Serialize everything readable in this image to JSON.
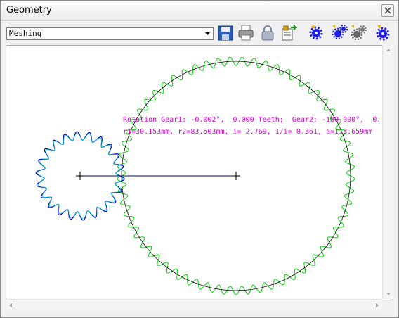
{
  "window": {
    "title": "Geometry"
  },
  "toolbar": {
    "mode_select": "Meshing",
    "buttons": [
      {
        "name": "save-icon"
      },
      {
        "name": "print-icon"
      },
      {
        "name": "lock-icon"
      },
      {
        "name": "export-icon"
      },
      {
        "name": "gear-icon-1"
      },
      {
        "name": "gear-icon-2"
      },
      {
        "name": "gear-icon-3"
      },
      {
        "name": "gear-icon-4"
      }
    ]
  },
  "drawing": {
    "line1": "Rotation Gear1: -0.002°,  0.000 Teeth;  Gear2: -180.000°,  0.",
    "line2": "r1=30.153mm, r2=83.503mm, i= 2.769, 1/i= 0.361, a=113.659mm",
    "colors": {
      "gear1": "#0000cc",
      "gear1_alt": "#00c8c8",
      "gear2": "#00cc00",
      "pitch": "#000000",
      "info": "#d600d6"
    }
  }
}
